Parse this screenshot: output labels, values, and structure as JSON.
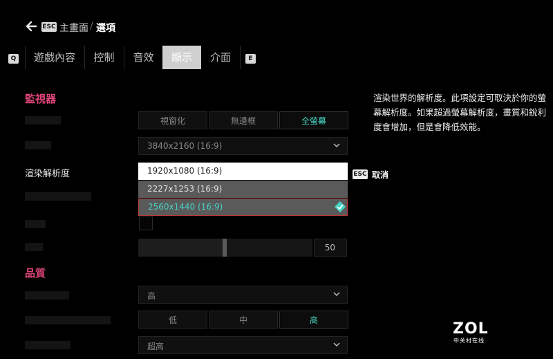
{
  "header": {
    "esc_key": "ESC",
    "home_label": "主畫面",
    "separator": "/",
    "current": "選項"
  },
  "tabs": {
    "prev_key": "Q",
    "next_key": "E",
    "items": [
      {
        "label": "遊戲內容",
        "active": false
      },
      {
        "label": "控制",
        "active": false
      },
      {
        "label": "音效",
        "active": false
      },
      {
        "label": "顯示",
        "active": true
      },
      {
        "label": "介面",
        "active": false
      }
    ]
  },
  "monitor": {
    "title": "監視器",
    "window_mode": {
      "options": [
        "視窗化",
        "無邊框",
        "全螢幕"
      ],
      "selected": "全螢幕"
    },
    "resolution_value": "3840x2160 (16:9)",
    "render_resolution_label": "渲染解析度",
    "render_options": [
      {
        "label": "1920x1080 (16:9)",
        "state": "highlighted"
      },
      {
        "label": "2227x1253 (16:9)",
        "state": "normal"
      },
      {
        "label": "2560x1440 (16:9)",
        "state": "selected"
      }
    ],
    "slider_value": "50",
    "slider_level": 0.5,
    "cancel_key": "ESC",
    "cancel_label": "取消"
  },
  "quality": {
    "title": "品質",
    "preset_value": "高",
    "lod": {
      "options": [
        "低",
        "中",
        "高"
      ],
      "selected": "高"
    },
    "last_value": "超高"
  },
  "description": "渲染世界的解析度。此項設定可取決於你的螢幕解析度。如果超過螢幕解析度，畫質和銳利度會增加，但是會降低效能。",
  "watermark": {
    "logo": "ZOL",
    "sub": "中关村在线"
  },
  "colors": {
    "accent_pink": "#e0457a",
    "accent_teal": "#48d4c4",
    "highlight": "#ffffff",
    "selected_border": "#c23b3b"
  }
}
